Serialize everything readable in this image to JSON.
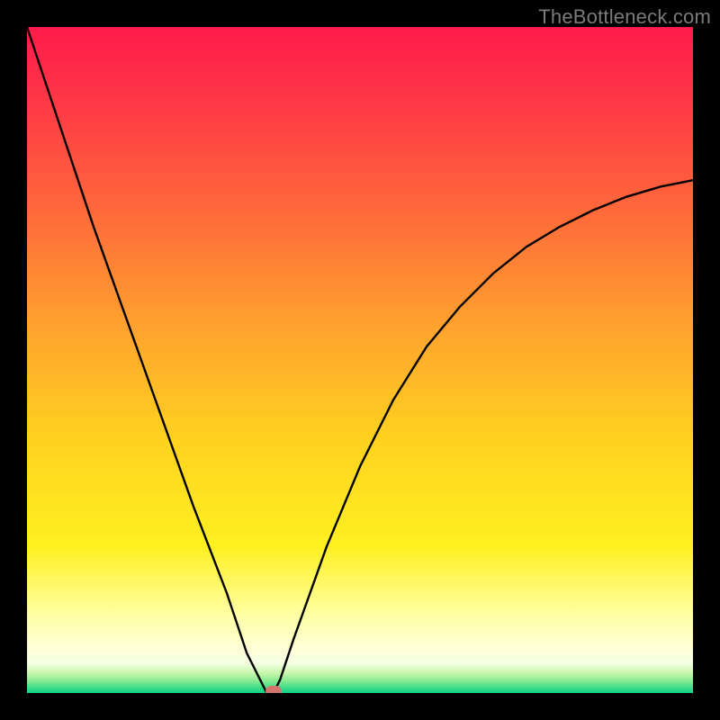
{
  "watermark": "TheBottleneck.com",
  "colors": {
    "black": "#000000",
    "marker": "#d3746d",
    "gradient_top": "#ff1a4b",
    "gradient_bottom": "#12d48a"
  },
  "chart_data": {
    "type": "line",
    "title": "",
    "xlabel": "",
    "ylabel": "",
    "xlim": [
      0,
      100
    ],
    "ylim": [
      0,
      100
    ],
    "x": [
      0,
      5,
      10,
      15,
      20,
      25,
      30,
      33,
      35,
      36,
      37,
      38,
      40,
      45,
      50,
      55,
      60,
      65,
      70,
      75,
      80,
      85,
      90,
      95,
      100
    ],
    "values": [
      100,
      85,
      70,
      56,
      42,
      28,
      15,
      6,
      2,
      0,
      0,
      2,
      8,
      22,
      34,
      44,
      52,
      58,
      63,
      67,
      70,
      72.5,
      74.5,
      76,
      77
    ],
    "flat_segment_x": [
      35,
      38
    ],
    "optimum_x": 37,
    "marker_y": 0,
    "annotations": []
  }
}
